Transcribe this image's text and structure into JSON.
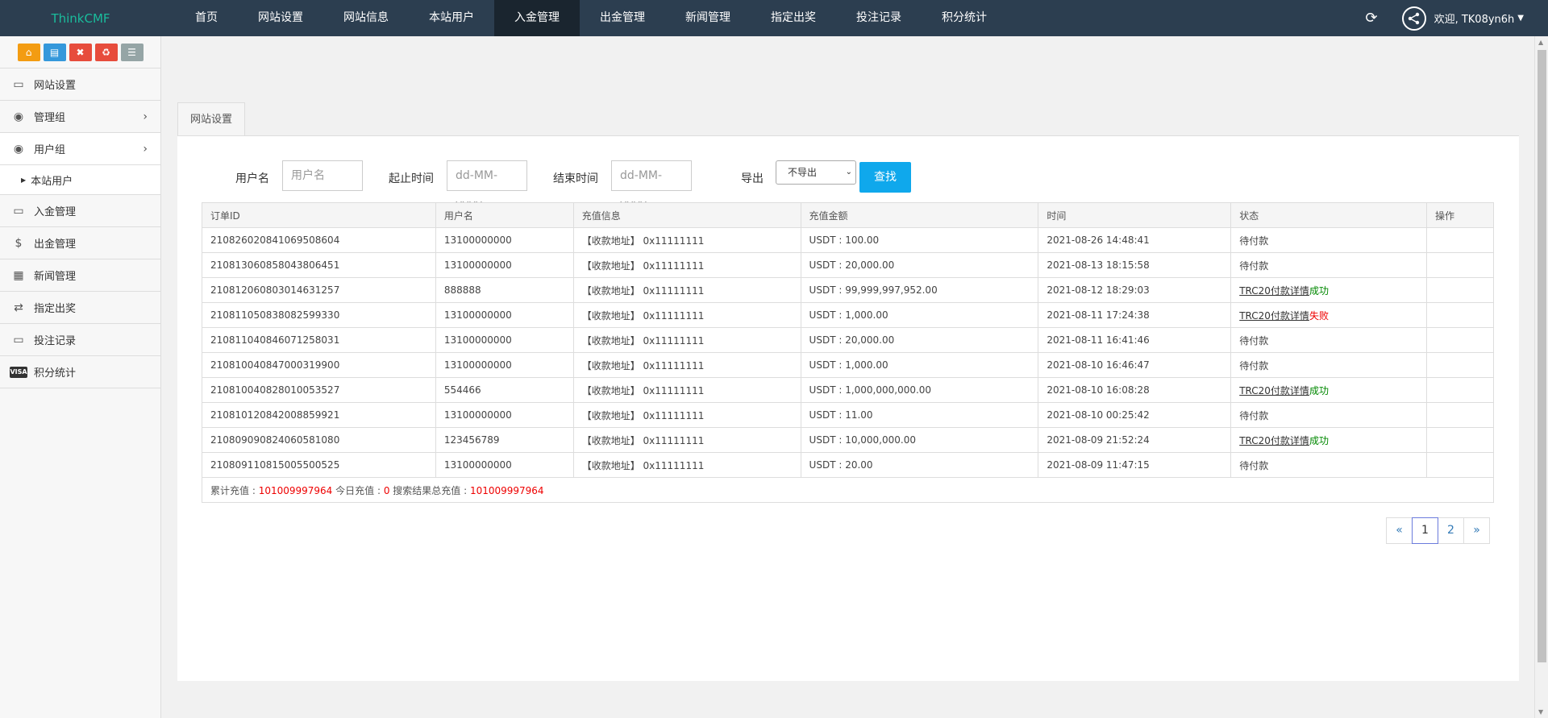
{
  "brand": "ThinkCMF",
  "topnav": [
    "首页",
    "网站设置",
    "网站信息",
    "本站用户",
    "入金管理",
    "出金管理",
    "新闻管理",
    "指定出奖",
    "投注记录",
    "积分统计"
  ],
  "user": {
    "welcome": "欢迎, TK08yn6h"
  },
  "sidebar": {
    "items": [
      {
        "label": "网站设置",
        "icon": "monitor-icon"
      },
      {
        "label": "管理组",
        "icon": "user-circle-icon"
      },
      {
        "label": "用户组",
        "icon": "user-circle-icon"
      },
      {
        "label": "入金管理",
        "icon": "monitor-icon"
      },
      {
        "label": "出金管理",
        "icon": "dollar-icon"
      },
      {
        "label": "新闻管理",
        "icon": "newspaper-icon"
      },
      {
        "label": "指定出奖",
        "icon": "exchange-icon"
      },
      {
        "label": "投注记录",
        "icon": "monitor-icon"
      },
      {
        "label": "积分统计",
        "icon": "visa-icon"
      }
    ],
    "sub": "本站用户"
  },
  "tab": "网站设置",
  "filters": {
    "username_label": "用户名",
    "username_placeholder": "用户名",
    "start_label": "起止时间",
    "start_placeholder": "dd-MM-yyyy",
    "end_label": "结束时间",
    "end_placeholder": "dd-MM-yyyy",
    "export_label": "导出",
    "export_value": "不导出",
    "search_label": "查找"
  },
  "table": {
    "headers": [
      "订单ID",
      "用户名",
      "充值信息",
      "充值金额",
      "时间",
      "状态",
      "操作"
    ],
    "rows": [
      {
        "id": "210826020841069508604",
        "user": "13100000000",
        "info": "【收款地址】 0x11111111",
        "amount": "USDT : 100.00",
        "time": "2021-08-26 14:48:41",
        "status": "待付款",
        "detail": "",
        "result": ""
      },
      {
        "id": "210813060858043806451",
        "user": "13100000000",
        "info": "【收款地址】 0x11111111",
        "amount": "USDT : 20,000.00",
        "time": "2021-08-13 18:15:58",
        "status": "待付款",
        "detail": "",
        "result": ""
      },
      {
        "id": "210812060803014631257",
        "user": "888888",
        "info": "【收款地址】 0x11111111",
        "amount": "USDT : 99,999,997,952.00",
        "time": "2021-08-12 18:29:03",
        "status": "",
        "detail": "TRC20付款详情",
        "result": "成功"
      },
      {
        "id": "210811050838082599330",
        "user": "13100000000",
        "info": "【收款地址】 0x11111111",
        "amount": "USDT : 1,000.00",
        "time": "2021-08-11 17:24:38",
        "status": "",
        "detail": "TRC20付款详情",
        "result": "失败"
      },
      {
        "id": "210811040846071258031",
        "user": "13100000000",
        "info": "【收款地址】 0x11111111",
        "amount": "USDT : 20,000.00",
        "time": "2021-08-11 16:41:46",
        "status": "待付款",
        "detail": "",
        "result": ""
      },
      {
        "id": "210810040847000319900",
        "user": "13100000000",
        "info": "【收款地址】 0x11111111",
        "amount": "USDT : 1,000.00",
        "time": "2021-08-10 16:46:47",
        "status": "待付款",
        "detail": "",
        "result": ""
      },
      {
        "id": "210810040828010053527",
        "user": "554466",
        "info": "【收款地址】 0x11111111",
        "amount": "USDT : 1,000,000,000.00",
        "time": "2021-08-10 16:08:28",
        "status": "",
        "detail": "TRC20付款详情",
        "result": "成功"
      },
      {
        "id": "210810120842008859921",
        "user": "13100000000",
        "info": "【收款地址】 0x11111111",
        "amount": "USDT : 11.00",
        "time": "2021-08-10 00:25:42",
        "status": "待付款",
        "detail": "",
        "result": ""
      },
      {
        "id": "210809090824060581080",
        "user": "123456789",
        "info": "【收款地址】 0x11111111",
        "amount": "USDT : 10,000,000.00",
        "time": "2021-08-09 21:52:24",
        "status": "",
        "detail": "TRC20付款详情",
        "result": "成功"
      },
      {
        "id": "210809110815005500525",
        "user": "13100000000",
        "info": "【收款地址】 0x11111111",
        "amount": "USDT : 20.00",
        "time": "2021-08-09 11:47:15",
        "status": "待付款",
        "detail": "",
        "result": ""
      }
    ],
    "summary": {
      "total_label": "累计充值 : ",
      "total_value": "101009997964",
      "today_label": " 今日充值 : ",
      "today_value": "0",
      "search_label": " 搜索结果总充值 : ",
      "search_value": "101009997964"
    }
  },
  "pager": [
    "«",
    "1",
    "2",
    "»"
  ],
  "colors": {
    "topbar": "#2c3e50",
    "brand": "#1abc9c",
    "search": "#0fa8ec",
    "success": "#008800",
    "fail": "#ee0000"
  }
}
